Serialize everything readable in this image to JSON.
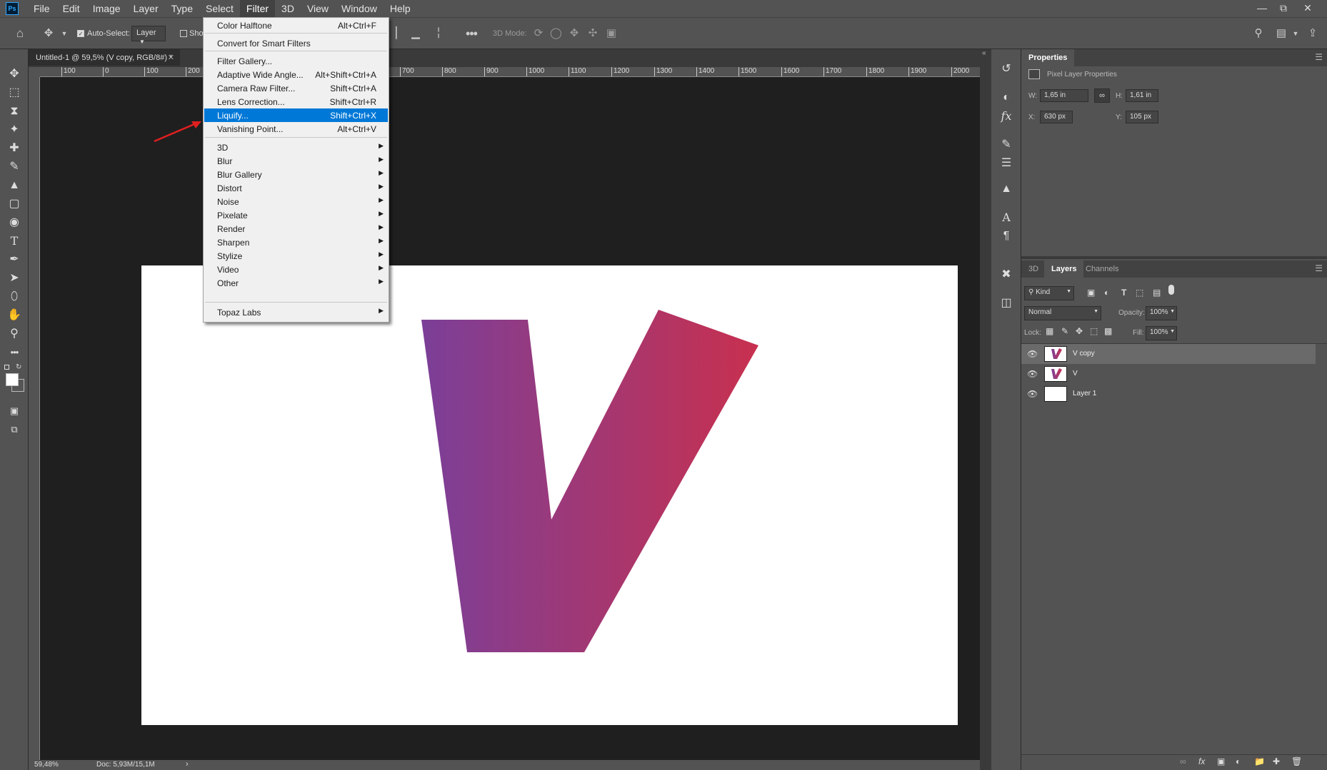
{
  "menubar": {
    "items": [
      "File",
      "Edit",
      "Image",
      "Layer",
      "Type",
      "Select",
      "Filter",
      "3D",
      "View",
      "Window",
      "Help"
    ],
    "active": "Filter",
    "logo": "Ps"
  },
  "options": {
    "auto_select_label": "Auto-Select:",
    "auto_select_target": "Layer",
    "show_label": "Sho",
    "mode_3d_label": "3D Mode:"
  },
  "document": {
    "tab_title": "Untitled-1 @ 59,5% (V copy, RGB/8#) *",
    "zoom": "59,48%",
    "doc_size": "Doc: 5,93M/15,1M"
  },
  "ruler": {
    "top_ticks": [
      "100",
      "0",
      "100",
      "200",
      "700",
      "800",
      "900",
      "1000",
      "1100",
      "1200",
      "1300",
      "1400",
      "1500",
      "1600",
      "1700",
      "1800",
      "1900",
      "2000"
    ]
  },
  "filter_menu": {
    "items": [
      {
        "label": "Color Halftone",
        "shortcut": "Alt+Ctrl+F"
      },
      {
        "label": "Convert for Smart Filters",
        "shortcut": ""
      },
      {
        "label": "Filter Gallery...",
        "shortcut": ""
      },
      {
        "label": "Adaptive Wide Angle...",
        "shortcut": "Alt+Shift+Ctrl+A"
      },
      {
        "label": "Camera Raw Filter...",
        "shortcut": "Shift+Ctrl+A"
      },
      {
        "label": "Lens Correction...",
        "shortcut": "Shift+Ctrl+R"
      },
      {
        "label": "Liquify...",
        "shortcut": "Shift+Ctrl+X"
      },
      {
        "label": "Vanishing Point...",
        "shortcut": "Alt+Ctrl+V"
      },
      {
        "label": "3D",
        "shortcut": ""
      },
      {
        "label": "Blur",
        "shortcut": ""
      },
      {
        "label": "Blur Gallery",
        "shortcut": ""
      },
      {
        "label": "Distort",
        "shortcut": ""
      },
      {
        "label": "Noise",
        "shortcut": ""
      },
      {
        "label": "Pixelate",
        "shortcut": ""
      },
      {
        "label": "Render",
        "shortcut": ""
      },
      {
        "label": "Sharpen",
        "shortcut": ""
      },
      {
        "label": "Stylize",
        "shortcut": ""
      },
      {
        "label": "Video",
        "shortcut": ""
      },
      {
        "label": "Other",
        "shortcut": ""
      },
      {
        "label": "Topaz Labs",
        "shortcut": ""
      }
    ],
    "highlighted": "Liquify..."
  },
  "properties": {
    "title": "Properties",
    "subtitle": "Pixel Layer Properties",
    "w_label": "W:",
    "w_value": "1,65 in",
    "h_label": "H:",
    "h_value": "1,61 in",
    "x_label": "X:",
    "x_value": "630 px",
    "y_label": "Y:",
    "y_value": "105 px"
  },
  "layers_panel": {
    "tabs": [
      "3D",
      "Layers",
      "Channels"
    ],
    "active_tab": "Layers",
    "kind_label": "Kind",
    "blend_mode": "Normal",
    "opacity_label": "Opacity:",
    "opacity_value": "100%",
    "lock_label": "Lock:",
    "fill_label": "Fill:",
    "fill_value": "100%",
    "layers": [
      {
        "name": "V copy",
        "selected": true
      },
      {
        "name": "V",
        "selected": false
      },
      {
        "name": "Layer 1",
        "selected": false
      }
    ]
  },
  "colors": {
    "gradient_start": "#7b3f98",
    "gradient_end": "#c8304f",
    "highlight": "#0078d7",
    "annotation_arrow": "#e01f1f"
  }
}
